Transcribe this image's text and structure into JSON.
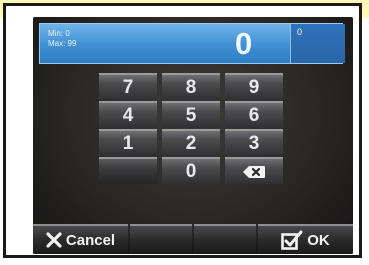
{
  "display": {
    "min_label": "Min: 0",
    "max_label": "Max: 99",
    "value": "0",
    "small_value": "0"
  },
  "keypad": {
    "keys": [
      "7",
      "8",
      "9",
      "4",
      "5",
      "6",
      "1",
      "2",
      "3",
      "",
      "0"
    ],
    "delete_icon": "backspace-icon"
  },
  "buttons": {
    "cancel_label": "Cancel",
    "ok_label": "OK"
  },
  "colors": {
    "display_blue": "#3f8fd2",
    "screen_bg": "#2a2725"
  }
}
